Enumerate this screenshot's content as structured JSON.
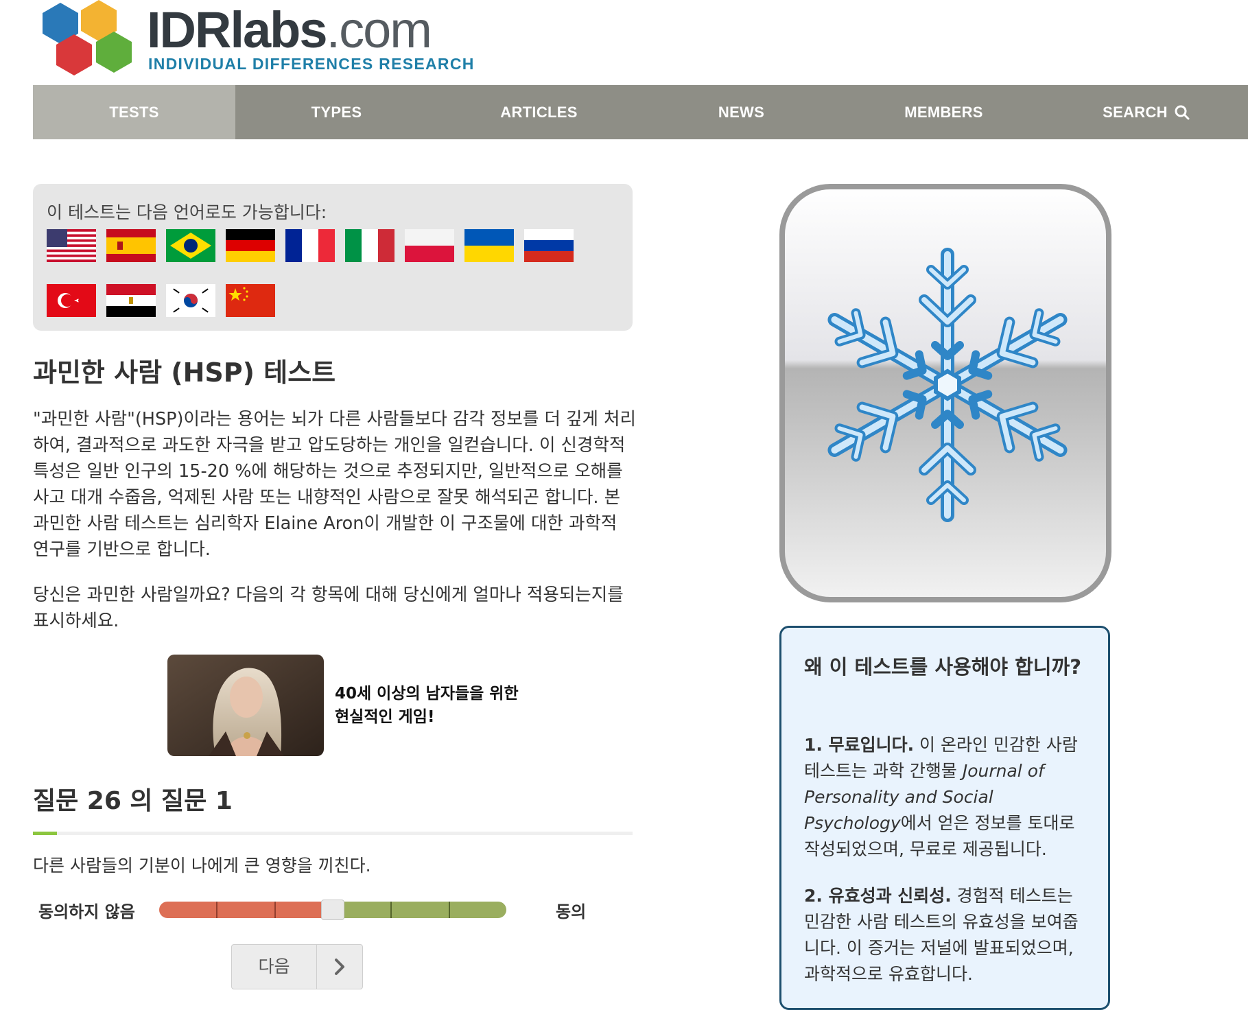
{
  "header": {
    "logo_brand": "IDRlabs",
    "logo_tld": ".com",
    "logo_subtitle": "INDIVIDUAL DIFFERENCES RESEARCH"
  },
  "nav": {
    "items": [
      "TESTS",
      "TYPES",
      "ARTICLES",
      "NEWS",
      "MEMBERS",
      "SEARCH"
    ],
    "active": "TESTS"
  },
  "languages": {
    "title": "이 테스트는 다음 언어로도 가능합니다:",
    "flags": [
      "us-flag-icon",
      "spain-flag-icon",
      "brazil-flag-icon",
      "germany-flag-icon",
      "france-flag-icon",
      "italy-flag-icon",
      "poland-flag-icon",
      "ukraine-flag-icon",
      "russia-flag-icon",
      "turkey-flag-icon",
      "egypt-flag-icon",
      "korea-flag-icon",
      "china-flag-icon"
    ]
  },
  "main": {
    "title": "과민한 사람 (HSP) 테스트",
    "intro": "\"과민한 사람\"(HSP)이라는 용어는 뇌가 다른 사람들보다 감각 정보를 더 깊게 처리하여, 결과적으로 과도한 자극을 받고 압도당하는 개인을 일컫습니다. 이 신경학적 특성은 일반 인구의 15-20 %에 해당하는 것으로 추정되지만, 일반적으로 오해를 사고 대개 수줍음, 억제된 사람 또는 내향적인 사람으로 잘못 해석되곤 합니다. 본 과민한 사람 테스트는 심리학자 Elaine Aron이 개발한 이 구조물에 대한 과학적 연구를 기반으로 합니다.",
    "prompt": "당신은 과민한 사람일까요? 다음의 각 항목에 대해 당신에게 얼마나 적용되는지를 표시하세요."
  },
  "ad": {
    "text": "40세 이상의 남자들을 위한 현실적인 게임!"
  },
  "question": {
    "title": "질문 26 의 질문 1",
    "progress": 0.04,
    "text": "다른 사람들의 기분이 나에게 큰 영향을 끼친다.",
    "label_disagree": "동의하지 않음",
    "label_agree": "동의",
    "slider_value": 0.5,
    "next_label": "다음"
  },
  "colors": {
    "nav_bg": "#8e8e86",
    "nav_active": "#b3b3ac",
    "slider_disagree": "#dd6f55",
    "slider_agree": "#9aae5f",
    "progress": "#8cc63f",
    "why_border": "#1d4f6e",
    "why_bg": "#e9f3fd"
  },
  "why": {
    "title": "왜 이 테스트를 사용해야 합니까?",
    "p1_bold": "1. 무료입니다.",
    "p1_text_a": " 이 온라인 민감한 사람 테스트는 과학 간행물 ",
    "p1_italic": "Journal of Personality and Social Psychology",
    "p1_text_b": "에서 얻은 정보를 토대로 작성되었으며, 무료로 제공됩니다.",
    "p2_bold": "2. 유효성과 신뢰성.",
    "p2_text": " 경험적 테스트는 민감한 사람 테스트의 유효성을 보여줍니다. 이 증거는 저널에 발표되었으며, 과학적으로 유효합니다."
  }
}
